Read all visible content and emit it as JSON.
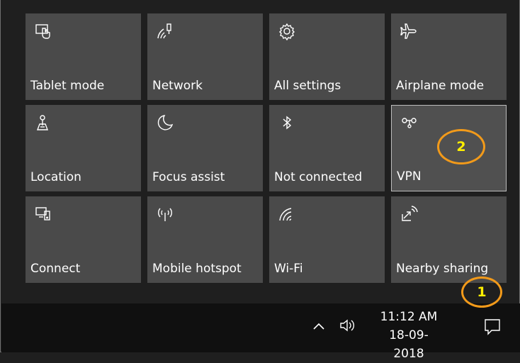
{
  "tiles": [
    {
      "label": "Tablet mode",
      "icon": "tablet-mode-icon"
    },
    {
      "label": "Network",
      "icon": "network-icon"
    },
    {
      "label": "All settings",
      "icon": "settings-gear-icon"
    },
    {
      "label": "Airplane mode",
      "icon": "airplane-icon"
    },
    {
      "label": "Location",
      "icon": "location-icon"
    },
    {
      "label": "Focus assist",
      "icon": "moon-icon"
    },
    {
      "label": "Not connected",
      "icon": "bluetooth-icon"
    },
    {
      "label": "VPN",
      "icon": "vpn-icon"
    },
    {
      "label": "Connect",
      "icon": "connect-icon"
    },
    {
      "label": "Mobile hotspot",
      "icon": "hotspot-icon"
    },
    {
      "label": "Wi-Fi",
      "icon": "wifi-icon"
    },
    {
      "label": "Nearby sharing",
      "icon": "nearby-sharing-icon"
    }
  ],
  "annotations": {
    "one": "1",
    "two": "2"
  },
  "taskbar": {
    "time": "11:12 AM",
    "date": "18-09-2018"
  },
  "colors": {
    "tile": "#4a4a4a",
    "annotation": "#f29a1a",
    "annotation_text": "#ffef00",
    "taskbar": "#101010"
  }
}
